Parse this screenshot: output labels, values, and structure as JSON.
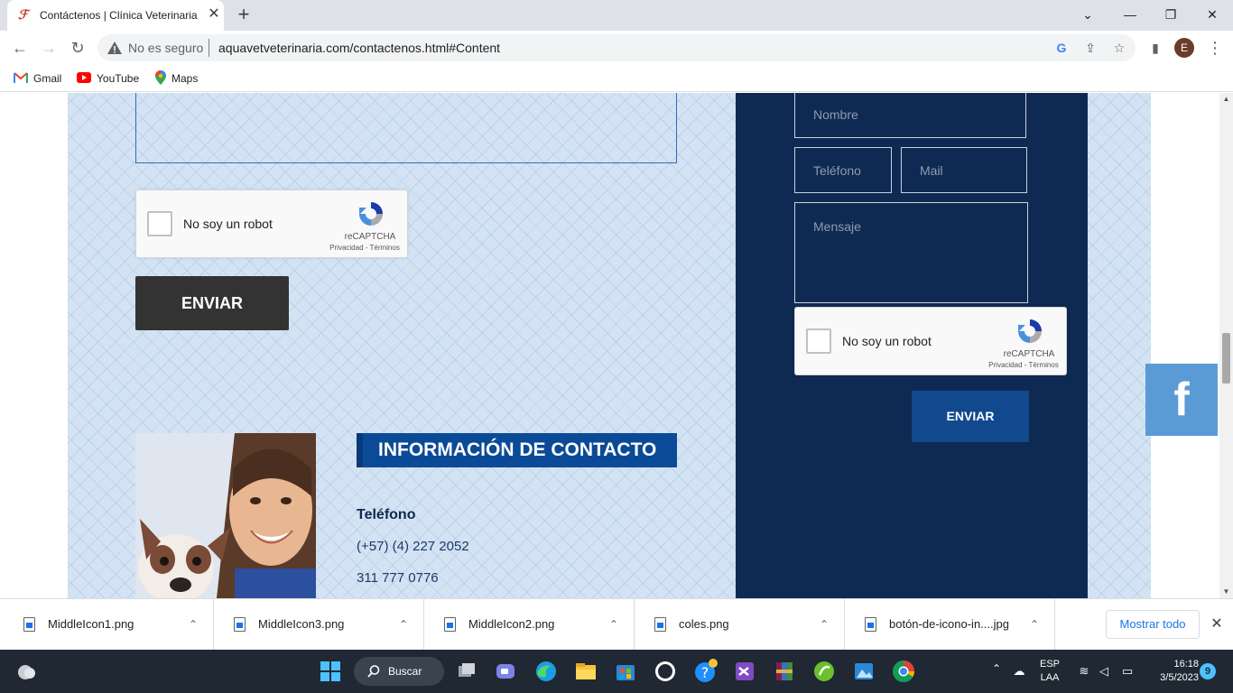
{
  "browser": {
    "tab": {
      "title": "Contáctenos | Clínica Veterinaria",
      "close": "✕",
      "new_tab": "+"
    },
    "window_controls": {
      "chevron": "⌄",
      "minimize": "—",
      "maximize": "❐",
      "close": "✕"
    },
    "nav": {
      "back": "←",
      "forward": "→",
      "reload": "↻"
    },
    "address": {
      "security_label": "No es seguro",
      "url": "aquavetveterinaria.com/contactenos.html#Content"
    },
    "profile_initial": "E",
    "menu": "⋮",
    "bookmarks": [
      {
        "label": "Gmail",
        "icon": "gmail-icon"
      },
      {
        "label": "YouTube",
        "icon": "youtube-icon"
      },
      {
        "label": "Maps",
        "icon": "maps-icon"
      }
    ]
  },
  "page": {
    "left_form": {
      "captcha": {
        "label": "No soy un robot",
        "brand": "reCAPTCHA",
        "links": "Privacidad - Términos"
      },
      "submit_label": "ENVIAR"
    },
    "contact_info": {
      "heading": "INFORMACIÓN DE CONTACTO",
      "phone_label": "Teléfono",
      "phone_1": "(+57) (4) 227 2052",
      "phone_2": "311 777 0776"
    },
    "right_form": {
      "name_placeholder": "Nombre",
      "phone_placeholder": "Teléfono",
      "mail_placeholder": "Mail",
      "message_placeholder": "Mensaje",
      "captcha": {
        "label": "No soy un robot",
        "brand": "reCAPTCHA",
        "links": "Privacidad - Términos"
      },
      "submit_label": "ENVIAR"
    },
    "facebook_label": "f",
    "colors": {
      "dark_panel": "#0f2a52",
      "accent_blue": "#0b4a96",
      "facebook": "#5b9bd5",
      "button_dark": "#333333"
    }
  },
  "downloads": {
    "items": [
      {
        "name": "MiddleIcon1.png"
      },
      {
        "name": "MiddleIcon3.png"
      },
      {
        "name": "MiddleIcon2.png"
      },
      {
        "name": "coles.png"
      },
      {
        "name": "botón-de-icono-in....jpg"
      }
    ],
    "show_all": "Mostrar todo",
    "close": "✕",
    "caret": "⌃"
  },
  "taskbar": {
    "search_label": "Buscar",
    "language": {
      "line1": "ESP",
      "line2": "LAA"
    },
    "clock": {
      "time": "16:18",
      "date": "3/5/2023"
    },
    "notifications": "9",
    "tray_caret": "⌃"
  }
}
